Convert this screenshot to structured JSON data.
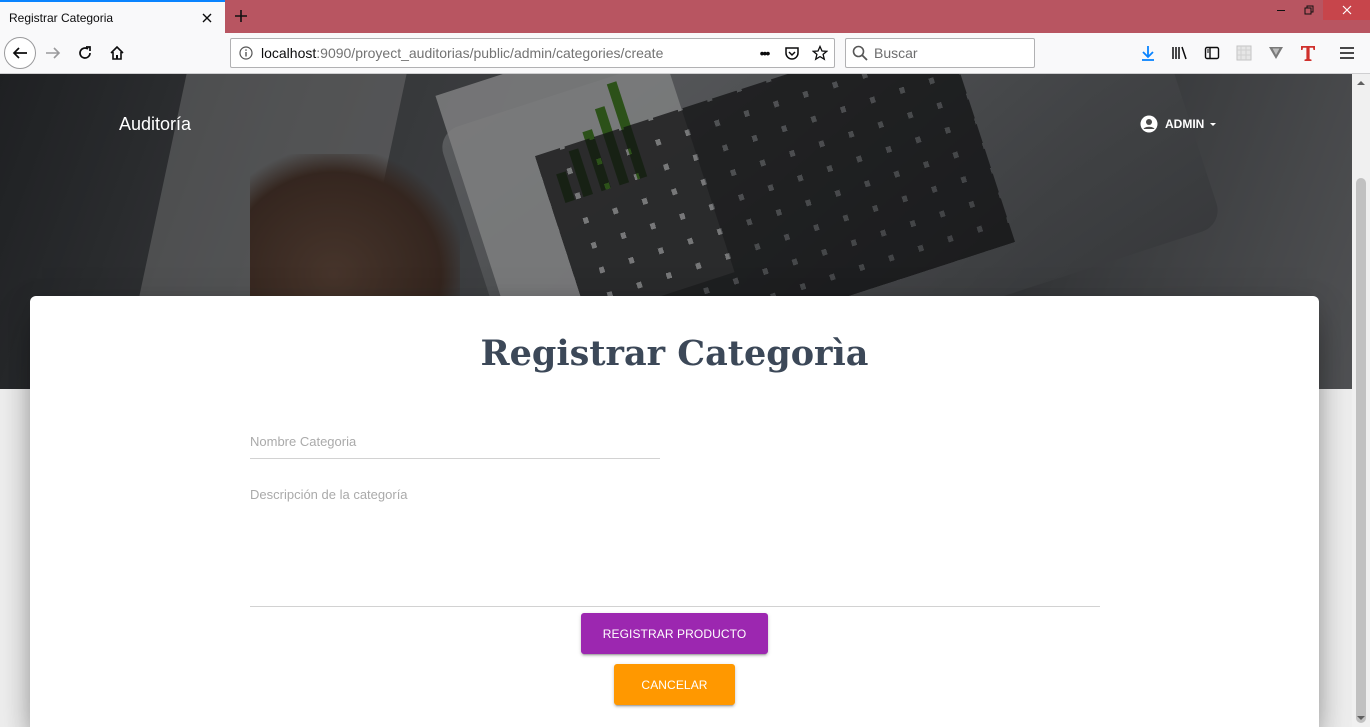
{
  "browser": {
    "tab_title": "Registrar Categoria",
    "url_host": "localhost",
    "url_rest": ":9090/proyect_auditorias/public/admin/categories/create",
    "page_actions": "•••",
    "search_placeholder": "Buscar",
    "icons": {
      "back": "back-arrow-icon",
      "forward": "forward-arrow-icon",
      "reload": "reload-icon",
      "home": "home-icon",
      "downloads": "download-icon",
      "library": "library-icon",
      "sidebar": "sidebar-icon",
      "menu": "hamburger-menu-icon"
    },
    "colors": {
      "tabbar": "#b85561",
      "accent": "#0a84ff"
    }
  },
  "page": {
    "brand": "Auditoría",
    "user_menu": {
      "label": "ADMIN"
    },
    "title": "Registrar Categorìa",
    "form": {
      "name_placeholder": "Nombre Categoria",
      "description_placeholder": "Descripción de la categoría",
      "submit_label": "REGISTRAR PRODUCTO",
      "cancel_label": "CANCELAR"
    },
    "colors": {
      "primary": "#9c27b0",
      "warning": "#ff9800",
      "title": "#3c4858"
    }
  }
}
